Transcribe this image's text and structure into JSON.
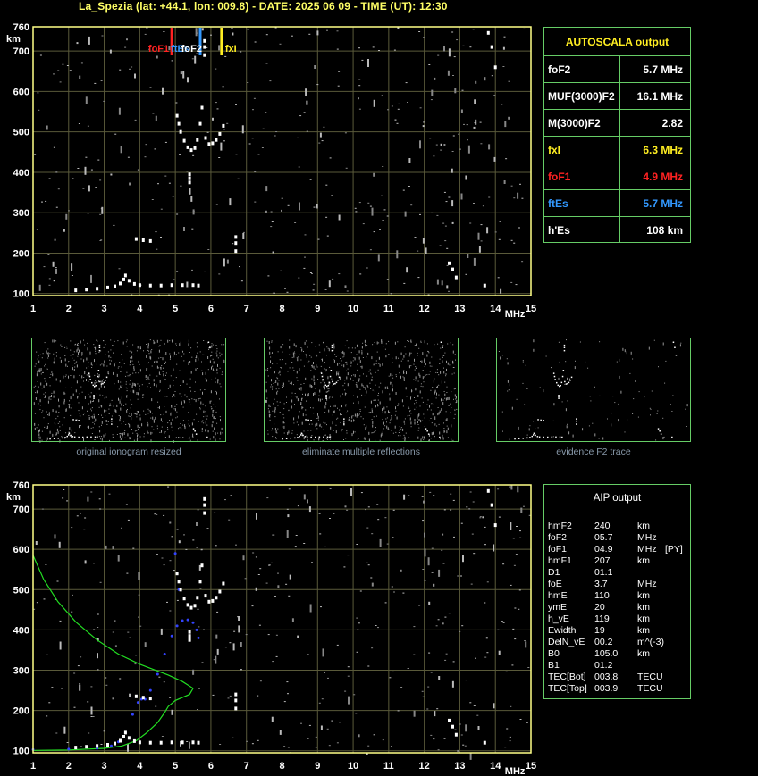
{
  "header": {
    "title": "La_Spezia (lat: +44.1, lon: 009.8) - DATE: 2025 06 09 - TIME (UT): 12:30"
  },
  "axes": {
    "y_unit": "km",
    "x_unit": "MHz",
    "y_ticks": [
      760,
      700,
      600,
      500,
      400,
      300,
      200,
      100
    ],
    "x_ticks": [
      1,
      2,
      3,
      4,
      5,
      6,
      7,
      8,
      9,
      10,
      11,
      12,
      13,
      14,
      15
    ],
    "xlim": [
      1,
      15
    ],
    "ylim": [
      95,
      760
    ]
  },
  "markers": [
    {
      "label": "foF1",
      "freq": 4.9,
      "color": "#ff2222"
    },
    {
      "label": "ftEs",
      "freq": 5.7,
      "color": "#3399ff"
    },
    {
      "label": "foF2",
      "freq": 5.7,
      "color": "#ffffff"
    },
    {
      "label": "fxI",
      "freq": 6.3,
      "color": "#ffee22"
    }
  ],
  "autoscala": {
    "title": "AUTOSCALA output",
    "rows": [
      {
        "key": "foF2",
        "value": "5.7 MHz",
        "color": "#ffffff"
      },
      {
        "key": "MUF(3000)F2",
        "value": "16.1 MHz",
        "color": "#ffffff"
      },
      {
        "key": "M(3000)F2",
        "value": "2.82",
        "color": "#ffffff"
      },
      {
        "key": "fxI",
        "value": "6.3 MHz",
        "color": "#ffee22"
      },
      {
        "key": "foF1",
        "value": "4.9 MHz",
        "color": "#ff2222"
      },
      {
        "key": "ftEs",
        "value": "5.7 MHz",
        "color": "#3399ff"
      },
      {
        "key": "h'Es",
        "value": "108     km",
        "color": "#ffffff"
      }
    ]
  },
  "thumbnails": [
    {
      "caption": "original ionogram resized"
    },
    {
      "caption": "eliminate multiple reflections"
    },
    {
      "caption": "evidence F2 trace"
    }
  ],
  "aip": {
    "title": "AIP output",
    "rows": [
      {
        "k": "hmF2",
        "v": "240",
        "u": "km",
        "x": ""
      },
      {
        "k": "foF2",
        "v": "05.7",
        "u": "MHz",
        "x": ""
      },
      {
        "k": "foF1",
        "v": "04.9",
        "u": "MHz",
        "x": "[PY]"
      },
      {
        "k": "hmF1",
        "v": "207",
        "u": "km",
        "x": ""
      },
      {
        "k": "D1",
        "v": "01.1",
        "u": "",
        "x": ""
      },
      {
        "k": "foE",
        "v": "3.7",
        "u": "MHz",
        "x": ""
      },
      {
        "k": "hmE",
        "v": "110",
        "u": "km",
        "x": ""
      },
      {
        "k": "ymE",
        "v": "20",
        "u": "km",
        "x": ""
      },
      {
        "k": "h_vE",
        "v": "119",
        "u": "km",
        "x": ""
      },
      {
        "k": "Ewidth",
        "v": "19",
        "u": "km",
        "x": ""
      },
      {
        "k": "DelN_vE",
        "v": "00.2",
        "u": "m^(-3)",
        "x": ""
      },
      {
        "k": "B0",
        "v": "105.0",
        "u": "km",
        "x": ""
      },
      {
        "k": "B1",
        "v": "01.2",
        "u": "",
        "x": ""
      },
      {
        "k": "TEC[Bot]",
        "v": "003.8",
        "u": "TECU",
        "x": ""
      },
      {
        "k": "TEC[Top]",
        "v": "003.9",
        "u": "TECU",
        "x": ""
      }
    ]
  },
  "chart_data": [
    {
      "type": "scatter",
      "title": "",
      "xlabel": "MHz",
      "ylabel": "km",
      "xlim": [
        1,
        15
      ],
      "ylim": [
        95,
        760
      ],
      "grid": true,
      "series": [
        {
          "name": "",
          "color": "#ffffff",
          "points": [
            [
              2.2,
              108
            ],
            [
              2.5,
              110
            ],
            [
              2.8,
              112
            ],
            [
              3.1,
              115
            ],
            [
              3.3,
              118
            ],
            [
              3.45,
              125
            ],
            [
              3.55,
              135
            ],
            [
              3.6,
              145
            ],
            [
              3.7,
              132
            ],
            [
              3.85,
              124
            ],
            [
              4.0,
              121
            ],
            [
              4.3,
              120
            ],
            [
              4.6,
              120
            ],
            [
              4.9,
              121
            ],
            [
              5.2,
              121
            ],
            [
              5.5,
              121
            ],
            [
              5.65,
              120
            ],
            [
              3.9,
              235
            ],
            [
              4.1,
              232
            ],
            [
              4.3,
              230
            ],
            [
              5.05,
              540
            ],
            [
              5.1,
              520
            ],
            [
              5.15,
              500
            ],
            [
              5.25,
              478
            ],
            [
              5.35,
              462
            ],
            [
              5.45,
              455
            ],
            [
              5.55,
              460
            ],
            [
              5.62,
              480
            ],
            [
              5.7,
              520
            ],
            [
              5.75,
              560
            ],
            [
              5.85,
              485
            ],
            [
              5.95,
              470
            ],
            [
              6.05,
              472
            ],
            [
              6.15,
              480
            ],
            [
              6.25,
              495
            ],
            [
              6.35,
              515
            ],
            [
              5.4,
              375
            ],
            [
              5.4,
              385
            ],
            [
              5.4,
              395
            ],
            [
              5.82,
              690
            ],
            [
              5.82,
              710
            ],
            [
              5.82,
              725
            ],
            [
              6.7,
              205
            ],
            [
              6.7,
              225
            ],
            [
              6.7,
              240
            ],
            [
              12.7,
              175
            ],
            [
              12.8,
              160
            ],
            [
              12.9,
              140
            ],
            [
              13.7,
              120
            ],
            [
              13.8,
              745
            ],
            [
              13.9,
              710
            ],
            [
              14.0,
              660
            ]
          ]
        }
      ]
    },
    {
      "type": "line",
      "title": "",
      "xlabel": "MHz",
      "ylabel": "km",
      "xlim": [
        1,
        15
      ],
      "ylim": [
        95,
        760
      ],
      "grid": true,
      "series": [
        {
          "name": "",
          "color": "#22dd22",
          "points": [
            [
              1.0,
              585
            ],
            [
              1.3,
              525
            ],
            [
              1.7,
              470
            ],
            [
              2.2,
              420
            ],
            [
              2.8,
              375
            ],
            [
              3.4,
              340
            ],
            [
              4.0,
              315
            ],
            [
              4.5,
              298
            ],
            [
              4.8,
              288
            ],
            [
              5.2,
              272
            ],
            [
              5.5,
              255
            ],
            [
              5.4,
              240
            ],
            [
              5.0,
              225
            ],
            [
              4.8,
              210
            ],
            [
              4.7,
              195
            ],
            [
              4.5,
              170
            ],
            [
              4.2,
              145
            ],
            [
              3.9,
              125
            ],
            [
              3.5,
              112
            ],
            [
              3.0,
              106
            ],
            [
              2.0,
              102
            ],
            [
              1.0,
              101
            ]
          ]
        },
        {
          "name": "",
          "color": "#3344ff",
          "points": [
            [
              1.0,
              103
            ],
            [
              2.0,
              104
            ],
            [
              2.8,
              106
            ],
            [
              3.2,
              112
            ],
            [
              3.4,
              122
            ],
            [
              3.6,
              145
            ],
            [
              3.8,
              190
            ],
            [
              3.95,
              220
            ],
            [
              4.05,
              228
            ],
            [
              4.15,
              228
            ],
            [
              4.3,
              250
            ],
            [
              4.5,
              290
            ],
            [
              4.7,
              340
            ],
            [
              4.9,
              385
            ],
            [
              5.05,
              410
            ],
            [
              5.2,
              423
            ],
            [
              5.35,
              425
            ],
            [
              5.5,
              418
            ],
            [
              5.6,
              400
            ],
            [
              5.65,
              380
            ],
            [
              5.1,
              500
            ],
            [
              5.05,
              540
            ],
            [
              5.0,
              590
            ]
          ]
        },
        {
          "name": "",
          "color": "#ffffff",
          "points": [
            [
              2.2,
              108
            ],
            [
              2.5,
              110
            ],
            [
              2.8,
              112
            ],
            [
              3.1,
              115
            ],
            [
              3.3,
              118
            ],
            [
              3.45,
              125
            ],
            [
              3.55,
              135
            ],
            [
              3.6,
              145
            ],
            [
              3.7,
              132
            ],
            [
              3.85,
              124
            ],
            [
              4.0,
              121
            ],
            [
              4.3,
              120
            ],
            [
              4.6,
              120
            ],
            [
              4.9,
              121
            ],
            [
              5.2,
              121
            ],
            [
              5.5,
              121
            ],
            [
              5.65,
              120
            ],
            [
              3.9,
              235
            ],
            [
              4.1,
              232
            ],
            [
              4.3,
              230
            ],
            [
              5.05,
              540
            ],
            [
              5.1,
              520
            ],
            [
              5.15,
              500
            ],
            [
              5.25,
              478
            ],
            [
              5.35,
              462
            ],
            [
              5.45,
              455
            ],
            [
              5.55,
              460
            ],
            [
              5.62,
              480
            ],
            [
              5.7,
              520
            ],
            [
              5.75,
              560
            ],
            [
              5.85,
              485
            ],
            [
              5.95,
              470
            ],
            [
              6.05,
              472
            ],
            [
              6.15,
              480
            ],
            [
              6.25,
              495
            ],
            [
              6.35,
              515
            ],
            [
              5.4,
              375
            ],
            [
              5.4,
              385
            ],
            [
              5.4,
              395
            ],
            [
              5.82,
              690
            ],
            [
              5.82,
              710
            ],
            [
              5.82,
              725
            ],
            [
              6.7,
              205
            ],
            [
              6.7,
              225
            ],
            [
              6.7,
              240
            ],
            [
              12.7,
              175
            ],
            [
              12.8,
              160
            ],
            [
              12.9,
              140
            ],
            [
              13.7,
              120
            ],
            [
              13.8,
              745
            ],
            [
              13.9,
              710
            ],
            [
              14.0,
              660
            ]
          ]
        }
      ]
    }
  ]
}
